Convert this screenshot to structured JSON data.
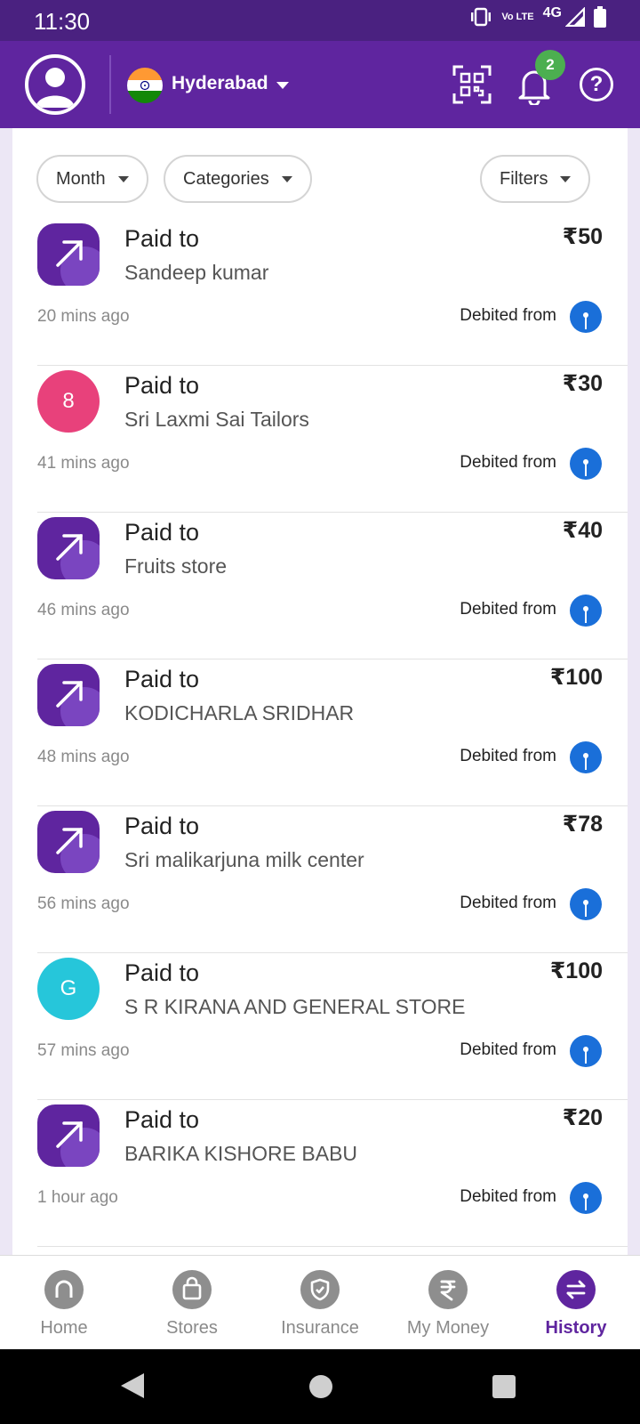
{
  "status_bar": {
    "time": "11:30",
    "volte_label": "Vo LTE",
    "network_label": "4G",
    "icons": [
      "vibrate-icon",
      "volte-icon",
      "signal-icon",
      "battery-icon"
    ]
  },
  "header": {
    "city": "Hyderabad",
    "notification_count": "2",
    "help_glyph": "?",
    "icons": [
      "avatar-icon",
      "india-flag-icon",
      "qr-scan-icon",
      "bell-icon",
      "help-icon"
    ],
    "brand_color": "#5f259f"
  },
  "filters": {
    "month": "Month",
    "categories": "Categories",
    "filters": "Filters"
  },
  "transactions": [
    {
      "title": "Paid to",
      "name": "Sandeep kumar",
      "amount": "₹50",
      "time": "20 mins ago",
      "debit_label": "Debited from",
      "icon": "arrow-up-right-icon"
    },
    {
      "title": "Paid to",
      "name": "Sri Laxmi Sai Tailors",
      "amount": "₹30",
      "time": "41 mins ago",
      "debit_label": "Debited from",
      "icon": "letter-avatar",
      "letter": "8",
      "color": "#e8417b"
    },
    {
      "title": "Paid to",
      "name": "Fruits store",
      "amount": "₹40",
      "time": "46 mins ago",
      "debit_label": "Debited from",
      "icon": "arrow-up-right-icon"
    },
    {
      "title": "Paid to",
      "name": "KODICHARLA SRIDHAR",
      "amount": "₹100",
      "time": "48 mins ago",
      "debit_label": "Debited from",
      "icon": "arrow-up-right-icon"
    },
    {
      "title": "Paid to",
      "name": "Sri malikarjuna milk center",
      "amount": "₹78",
      "time": "56 mins ago",
      "debit_label": "Debited from",
      "icon": "arrow-up-right-icon"
    },
    {
      "title": "Paid to",
      "name": "S R KIRANA AND GENERAL STORE",
      "amount": "₹100",
      "time": "57 mins ago",
      "debit_label": "Debited from",
      "icon": "letter-avatar",
      "letter": "G",
      "color": "#26c6da"
    },
    {
      "title": "Paid to",
      "name": "BARIKA KISHORE BABU",
      "amount": "₹20",
      "time": "1 hour ago",
      "debit_label": "Debited from",
      "icon": "arrow-up-right-icon"
    }
  ],
  "bottom_nav": {
    "home": "Home",
    "stores": "Stores",
    "insurance": "Insurance",
    "my_money": "My Money",
    "history": "History",
    "active": "History"
  }
}
